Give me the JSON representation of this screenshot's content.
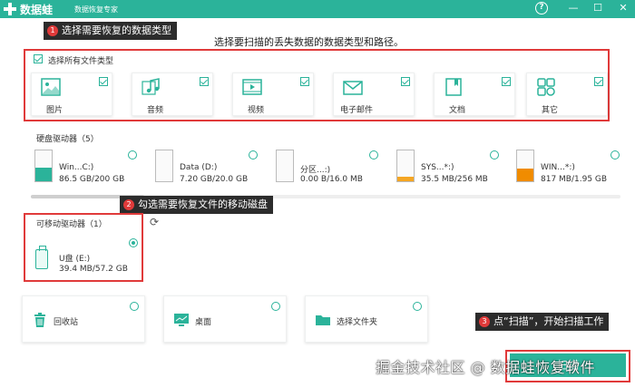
{
  "app": {
    "name": "数据蛙",
    "subtitle": "数据恢复专家"
  },
  "window_controls": {
    "help": "?",
    "minimize": "—",
    "maximize": "☐",
    "close": "✕"
  },
  "instruction": "选择要扫描的丢失数据的数据类型和路径。",
  "callouts": [
    {
      "num": "1",
      "text": "选择需要恢复的数据类型"
    },
    {
      "num": "2",
      "text": "勾选需要恢复文件的移动磁盘"
    },
    {
      "num": "3",
      "text": "点“扫描”，开始扫描工作"
    }
  ],
  "file_types": {
    "select_all_label": "选择所有文件类型",
    "select_all_checked": true,
    "items": [
      {
        "label": "图片",
        "icon": "image-icon",
        "checked": true
      },
      {
        "label": "音频",
        "icon": "audio-icon",
        "checked": true
      },
      {
        "label": "视频",
        "icon": "video-icon",
        "checked": true
      },
      {
        "label": "电子邮件",
        "icon": "email-icon",
        "checked": true
      },
      {
        "label": "文档",
        "icon": "document-icon",
        "checked": true
      },
      {
        "label": "其它",
        "icon": "other-icon",
        "checked": true
      }
    ]
  },
  "hard_drives": {
    "title": "硬盘驱动器（5）",
    "items": [
      {
        "name": "Win...C:)",
        "size": "86.5 GB/200 GB",
        "used_fraction": 0.43,
        "fill_color": "#2bb39a"
      },
      {
        "name": "Data (D:)",
        "size": "7.20 GB/20.0 GB",
        "used_fraction": 0.0,
        "fill_color": "#2bb39a"
      },
      {
        "name": "分区...:)",
        "size": "0.00  B/16.0 MB",
        "used_fraction": 0.0,
        "fill_color": "#2bb39a"
      },
      {
        "name": "SYS...*:)",
        "size": "35.5 MB/256 MB",
        "used_fraction": 0.14,
        "fill_color": "#f5a623"
      },
      {
        "name": "WIN...*:)",
        "size": "817 MB/1.95 GB",
        "used_fraction": 0.42,
        "fill_color": "#f08c00"
      }
    ]
  },
  "removable_drives": {
    "title": "可移动驱动器（1）",
    "items": [
      {
        "name": "U盘 (E:)",
        "size": "39.4 MB/57.2 GB",
        "selected": true
      }
    ]
  },
  "locations": [
    {
      "label": "回收站",
      "icon": "recycle-bin-icon"
    },
    {
      "label": "桌面",
      "icon": "desktop-icon"
    },
    {
      "label": "选择文件夹",
      "icon": "folder-icon"
    }
  ],
  "scan_button_label": "扫描",
  "watermark": "掘金技术社区 @ 数据蛙恢复软件",
  "colors": {
    "accent": "#2bb39a",
    "annotation_red": "#e03a3a",
    "callout_bg": "#2c2c2c"
  }
}
